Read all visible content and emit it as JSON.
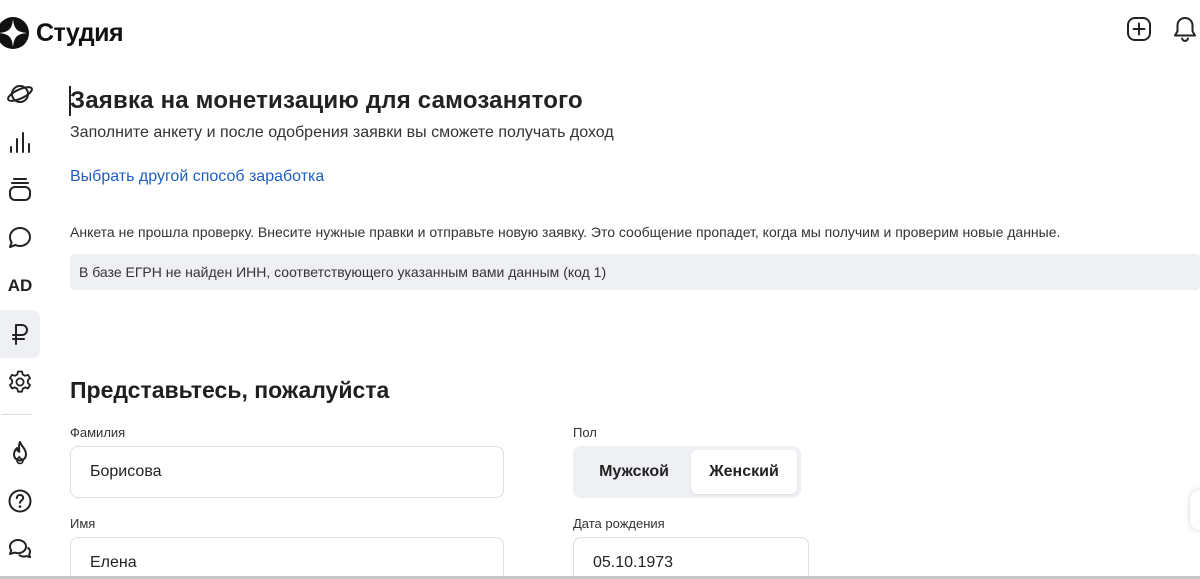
{
  "app": {
    "logo_text": "Студия"
  },
  "sidebar": {
    "items": [
      {
        "icon": "planet-icon"
      },
      {
        "icon": "stats-icon"
      },
      {
        "icon": "content-stack-icon"
      },
      {
        "icon": "comment-icon"
      },
      {
        "icon": "ad-icon",
        "label": "AD"
      },
      {
        "icon": "ruble-icon",
        "active": true
      },
      {
        "icon": "gear-icon"
      },
      {
        "icon": "fire-icon"
      },
      {
        "icon": "help-icon"
      },
      {
        "icon": "chat-icon"
      }
    ]
  },
  "header": {
    "actions": [
      "add-icon",
      "bell-icon"
    ]
  },
  "main": {
    "title": "Заявка на монетизацию для самозанятого",
    "subtitle": "Заполните анкету и после одобрения заявки вы сможете получать доход",
    "link": "Выбрать другой способ заработка",
    "warning": "Анкета не прошла проверку. Внесите нужные правки и отправьте новую заявку. Это сообщение пропадет, когда мы получим и проверим новые данные.",
    "error": "В базе ЕГРН не найден ИНН, соответствующего указанным вами данным (код 1)"
  },
  "form": {
    "section_title": "Представьтесь, пожалуйста",
    "surname": {
      "label": "Фамилия",
      "value": "Борисова"
    },
    "name": {
      "label": "Имя",
      "value": "Елена"
    },
    "gender": {
      "label": "Пол",
      "options": [
        "Мужской",
        "Женский"
      ],
      "selected": "Женский"
    },
    "birthdate": {
      "label": "Дата рождения",
      "value": "05.10.1973"
    }
  },
  "colors": {
    "link": "#1f5fc1",
    "panel": "#eef0f3",
    "text": "#222222"
  }
}
